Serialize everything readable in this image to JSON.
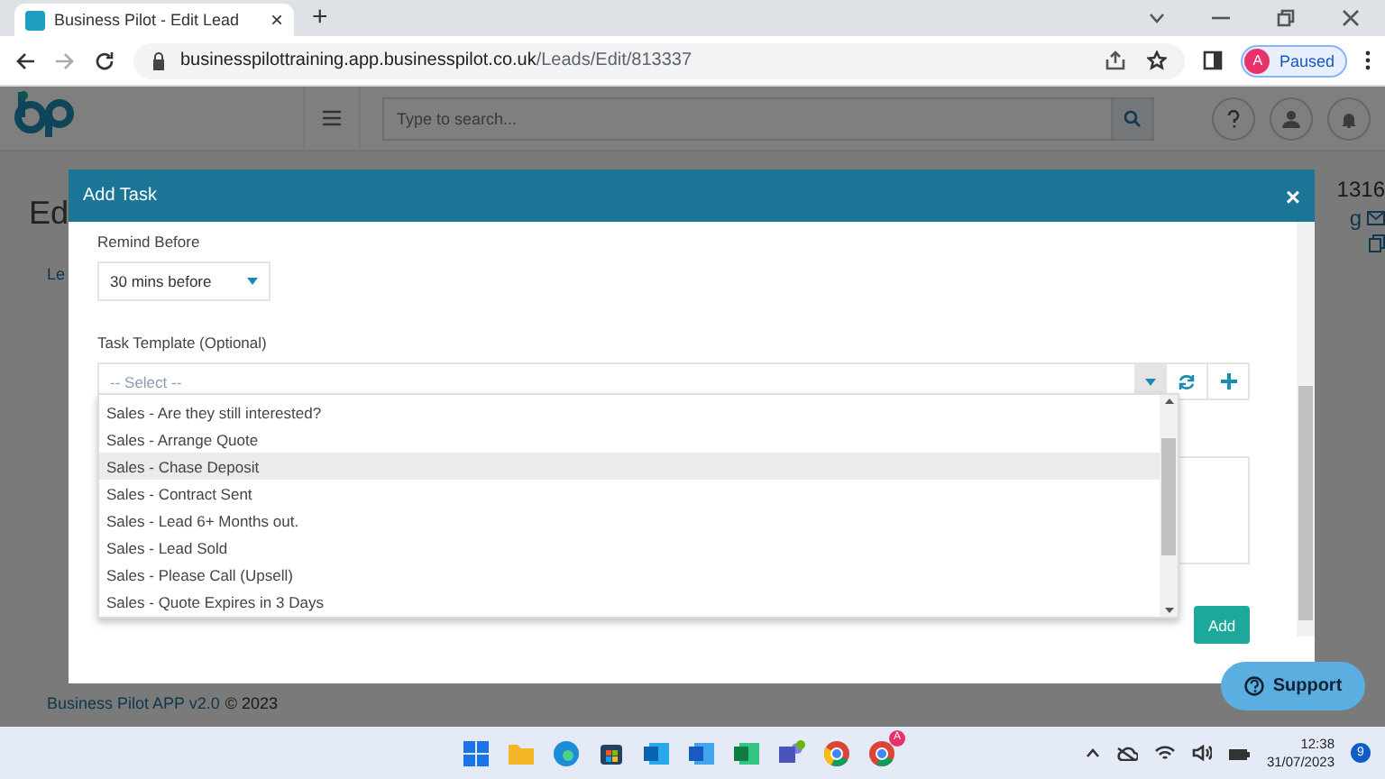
{
  "browser": {
    "tab_title": "Business Pilot - Edit Lead",
    "tab_close": "×",
    "new_tab": "+",
    "url_domain": "businesspilottraining.app.businesspilot.co.uk",
    "url_path": "/Leads/Edit/813337",
    "profile_initial": "A",
    "profile_status": "Paused"
  },
  "app": {
    "search_placeholder": "Type to search...",
    "page_title_fragment": "Ed",
    "tab_fragment": "Le",
    "lead_number_fragment": "1316",
    "link_fragment": "g",
    "footer_link": "Business Pilot APP v2.0",
    "footer_copyright": "© 2023",
    "support": "Support"
  },
  "modal": {
    "title": "Add Task",
    "close": "×",
    "remind_label": "Remind Before",
    "remind_value": "30 mins before",
    "template_label": "Task Template (Optional)",
    "template_placeholder": "-- Select --",
    "options": [
      {
        "label": "Sales - Are they still interested?",
        "selected": false
      },
      {
        "label": "Sales - Arrange Quote",
        "selected": false
      },
      {
        "label": "Sales - Chase Deposit",
        "selected": true
      },
      {
        "label": "Sales - Contract Sent",
        "selected": false
      },
      {
        "label": "Sales - Lead 6+ Months out.",
        "selected": false
      },
      {
        "label": "Sales - Lead Sold",
        "selected": false
      },
      {
        "label": "Sales - Please Call (Upsell)",
        "selected": false
      },
      {
        "label": "Sales - Quote Expires in 3 Days",
        "selected": false
      }
    ],
    "add": "Add"
  },
  "taskbar": {
    "chrome_badge": "A",
    "time": "12:38",
    "date": "31/07/2023",
    "notifications": "9"
  }
}
